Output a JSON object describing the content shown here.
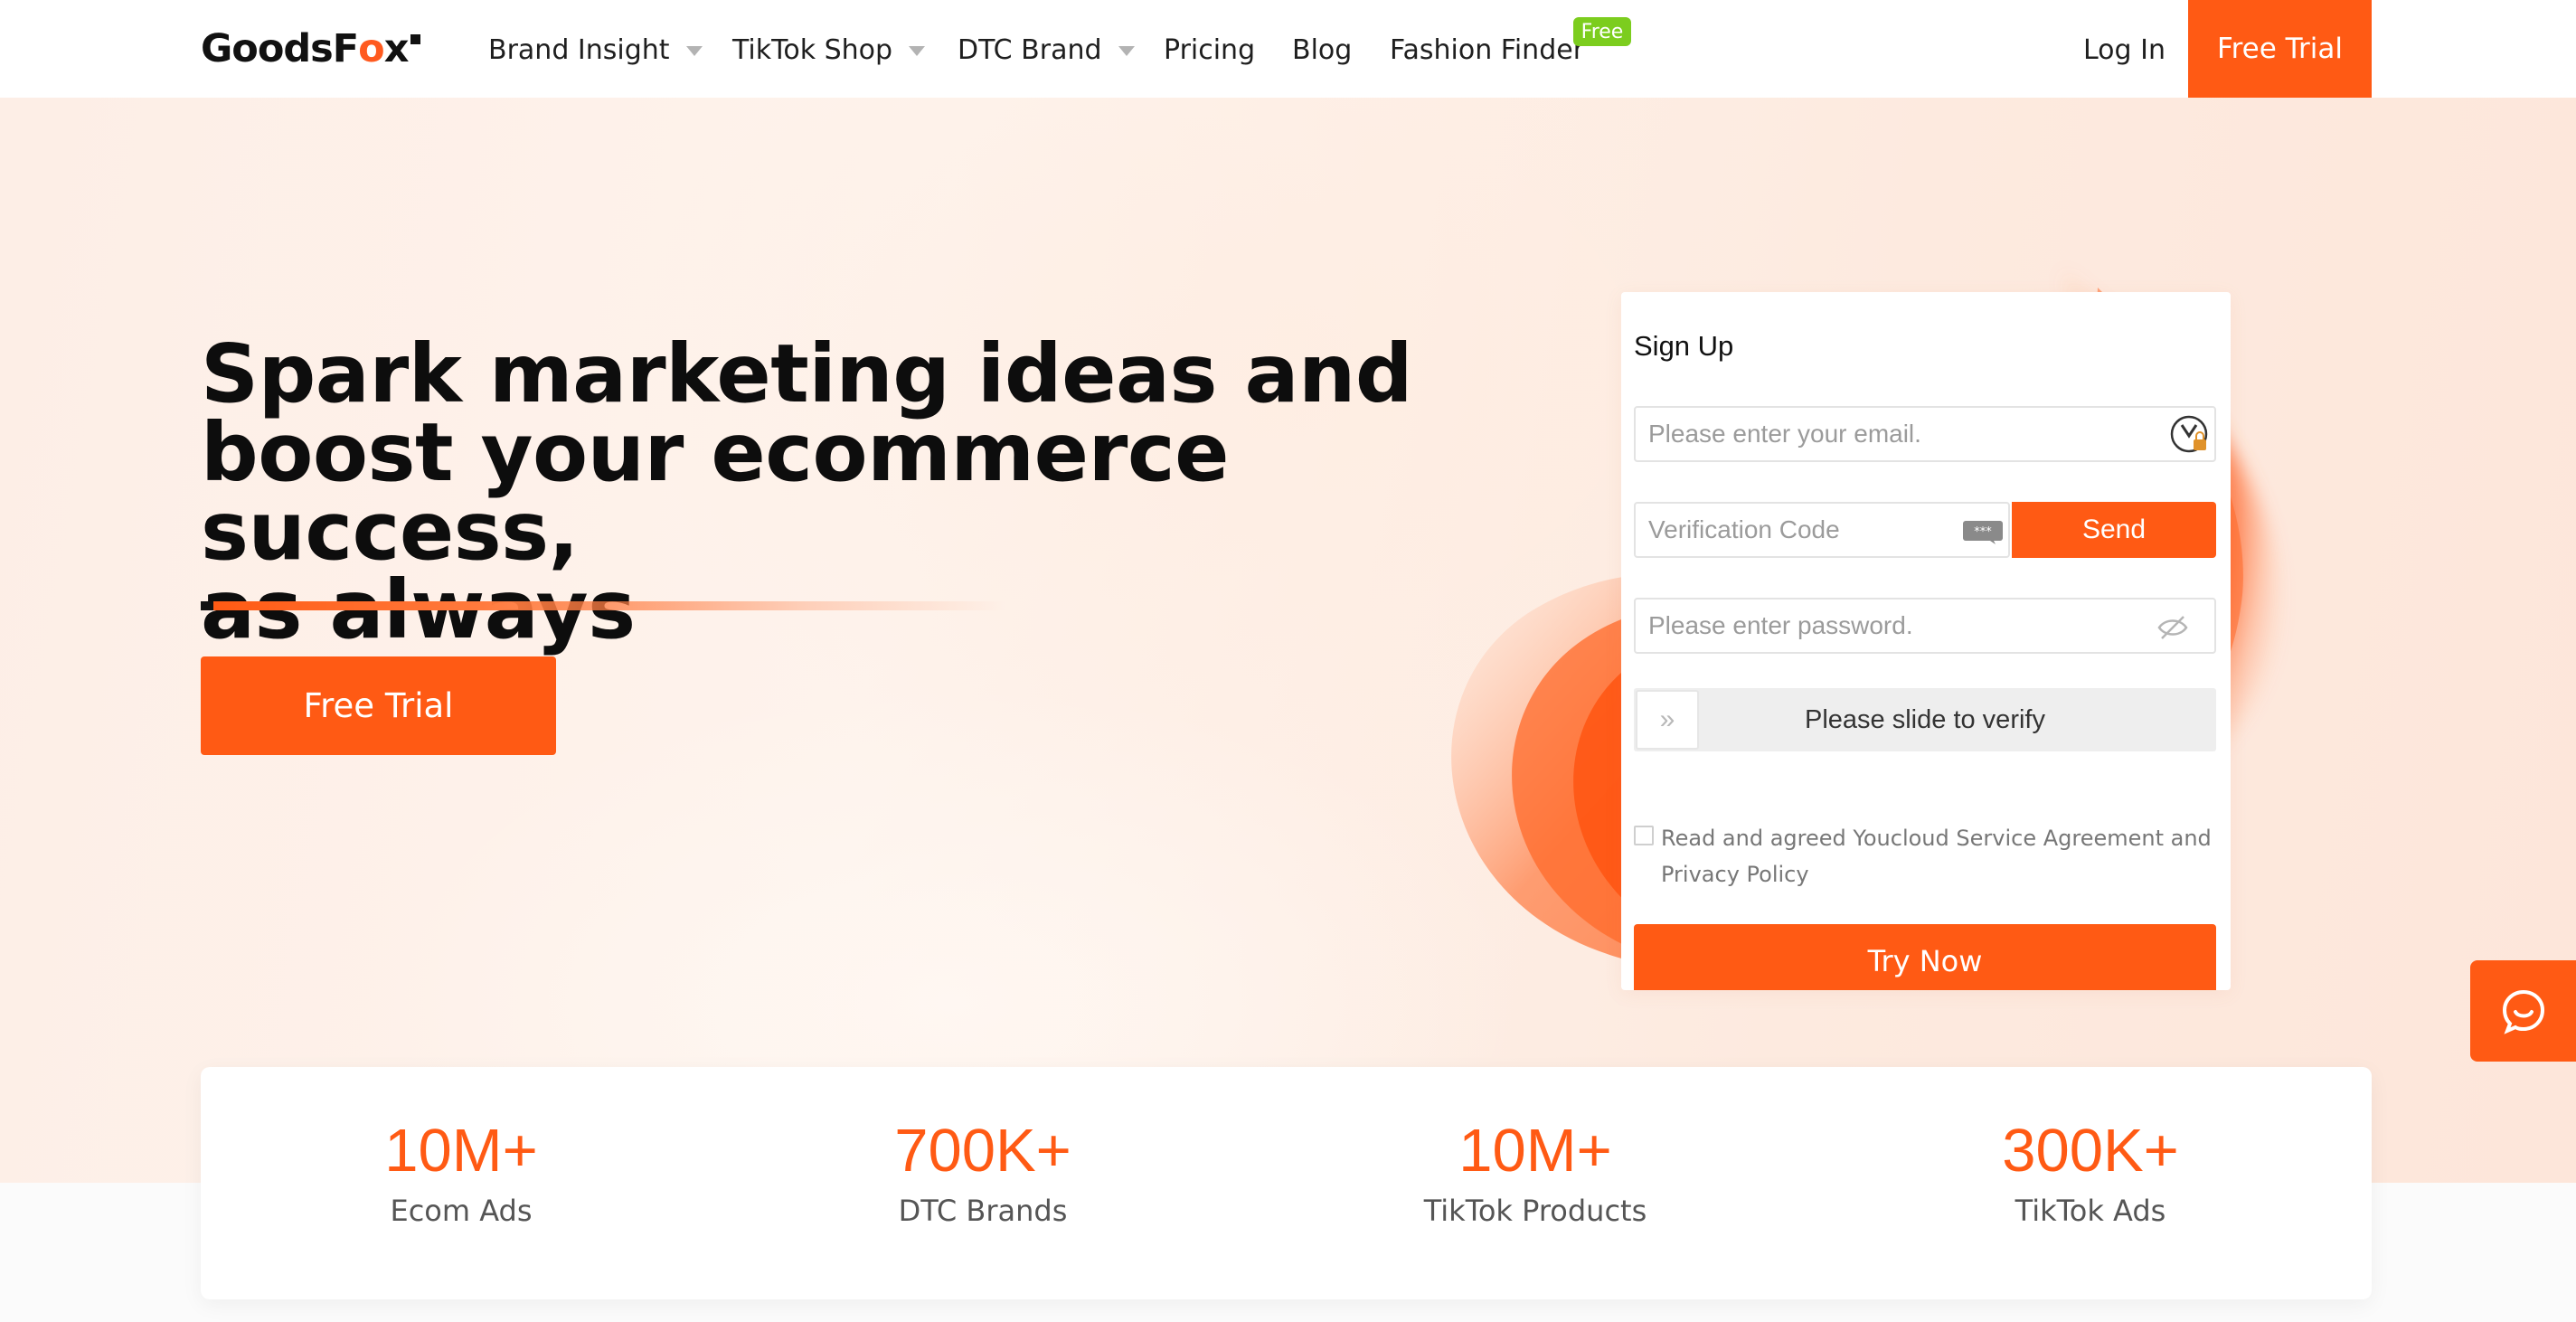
{
  "brand": {
    "logo_text_a": "GoodsF",
    "logo_text_b": "o",
    "logo_text_c": "x"
  },
  "nav": {
    "items": [
      {
        "label": "Brand Insight",
        "dropdown": true
      },
      {
        "label": "TikTok Shop",
        "dropdown": true
      },
      {
        "label": "DTC Brand",
        "dropdown": true
      },
      {
        "label": "Pricing",
        "dropdown": false
      },
      {
        "label": "Blog",
        "dropdown": false
      },
      {
        "label": "Fashion Finder",
        "dropdown": false,
        "badge": "Free"
      }
    ],
    "login": "Log In",
    "trial": "Free Trial"
  },
  "hero": {
    "headline_line1": "Spark marketing ideas and",
    "headline_line2": "boost your ecommerce success,",
    "headline_line3": "as always",
    "cta": "Free Trial"
  },
  "signup": {
    "title": "Sign Up",
    "email_placeholder": "Please enter your email.",
    "code_placeholder": "Verification Code",
    "send": "Send",
    "password_placeholder": "Please enter password.",
    "slider_text": "Please slide to verify",
    "slider_handle": "»",
    "agreement_line1": "Read and agreed Youcloud Service Agreement and",
    "agreement_line2": "Privacy Policy",
    "submit": "Try Now"
  },
  "stats": [
    {
      "value": "10M+",
      "label": "Ecom Ads"
    },
    {
      "value": "700K+",
      "label": "DTC Brands"
    },
    {
      "value": "10M+",
      "label": "TikTok Products"
    },
    {
      "value": "300K+",
      "label": "TikTok Ads"
    }
  ],
  "colors": {
    "accent": "#ff5a14",
    "badge": "#7ccd1e",
    "hero_bg": "#fdeee6"
  },
  "icons": [
    "caret-down-icon",
    "email-icon",
    "message-icon",
    "eye-off-icon",
    "chevron-double-right-icon",
    "chat-icon"
  ]
}
